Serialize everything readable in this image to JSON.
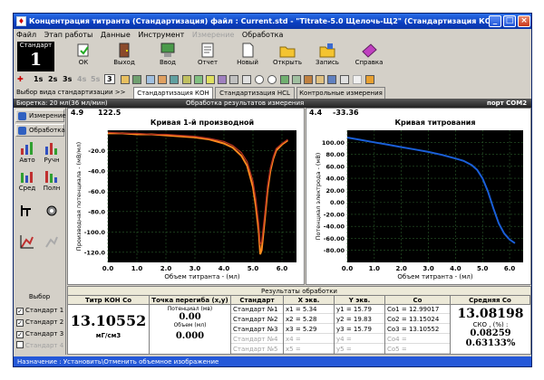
{
  "window": {
    "title": "Концентрация титранта (Стандартизация) файл : Current.std - \"Titrate-5.0 Щелочь-Щ2\" (Стандартизация КОН)"
  },
  "menu": [
    "Файл",
    "Этап работы",
    "Данные",
    "Инструмент",
    "Измерение",
    "Обработка"
  ],
  "menu_disabled": [
    4
  ],
  "toolbar": {
    "standard_label": "Стандарт",
    "standard_number": "1",
    "buttons": [
      "ОК",
      "Выход",
      "Ввод",
      "Отчет",
      "Новый",
      "Открыть",
      "Запись",
      "Справка"
    ]
  },
  "speeds": [
    "1s",
    "2s",
    "3s",
    "4s",
    "5s"
  ],
  "speed_spinner": "3",
  "tabs": {
    "lead": "Выбор вида стандартизации  >>",
    "items": [
      "Стандартизация КОН",
      "Стандартизация НCL",
      "Контрольные измерения"
    ]
  },
  "info": {
    "burette": "Бюретка: 20 мл(36 мл/мин)",
    "processing": "Обработка результатов измерения",
    "port": "порт COM2"
  },
  "left_panel": {
    "measure": "Измерение",
    "process": "Обработка",
    "icons": [
      "Авто",
      "Ручн",
      "Сред",
      "Полн"
    ],
    "vybor": "Выбор",
    "standards": [
      "Стандарт 1",
      "Стандарт 2",
      "Стандарт 3",
      "Стандарт 4",
      "Стандарт 5"
    ],
    "checked": [
      true,
      true,
      true,
      false,
      false
    ]
  },
  "chart1": {
    "readout_x": "4.9",
    "readout_y": "122.5",
    "title": "Кривая 1-й производной",
    "xlabel": "Объем титранта - (мл)",
    "ylabel": "Производная потенциала - (мВ/мл)"
  },
  "chart2": {
    "readout_x": "4.4",
    "readout_y": "-33.36",
    "title": "Кривая титрования",
    "xlabel": "Объем титранта - (мл)",
    "ylabel": "Потенциал электрода - (мВ)"
  },
  "chart_data": [
    {
      "type": "line",
      "title": "Кривая 1-й производной",
      "xlabel": "Объем титранта - (мл)",
      "ylabel": "Производная потенциала - (мВ/мл)",
      "xlim": [
        0,
        6.5
      ],
      "ylim": [
        -130,
        0
      ],
      "x_ticks": [
        "0.0",
        "1.0",
        "2.0",
        "3.0",
        "4.0",
        "5.0",
        "6.0"
      ],
      "y_ticks": [
        "-120.0",
        "-100.0",
        "-80.0",
        "-60.0",
        "-40.0",
        "-20.0"
      ],
      "grid": true,
      "series": [
        {
          "color": "#ff8a1e",
          "x": [
            0.0,
            0.5,
            1.0,
            1.5,
            2.0,
            2.5,
            3.0,
            3.5,
            4.0,
            4.3,
            4.6,
            4.8,
            5.0,
            5.1,
            5.2,
            5.25,
            5.3,
            5.4,
            5.5,
            5.6,
            5.7,
            5.8,
            6.0,
            6.2
          ],
          "y": [
            -3,
            -3,
            -4,
            -4,
            -5,
            -6,
            -7,
            -9,
            -13,
            -17,
            -25,
            -35,
            -56,
            -75,
            -100,
            -122,
            -118,
            -90,
            -60,
            -40,
            -28,
            -20,
            -14,
            -10
          ]
        },
        {
          "color": "#b03020",
          "x": [
            0.0,
            0.5,
            1.0,
            1.5,
            2.0,
            2.5,
            3.0,
            3.5,
            4.0,
            4.3,
            4.6,
            4.8,
            5.0,
            5.1,
            5.2,
            5.25,
            5.3,
            5.4,
            5.5,
            5.6,
            5.7,
            5.8,
            6.0,
            6.2
          ],
          "y": [
            -2,
            -3,
            -3,
            -4,
            -4,
            -5,
            -6,
            -8,
            -11,
            -15,
            -22,
            -31,
            -50,
            -68,
            -92,
            -112,
            -110,
            -84,
            -55,
            -37,
            -26,
            -18,
            -13,
            -9
          ]
        }
      ]
    },
    {
      "type": "line",
      "title": "Кривая титрования",
      "xlabel": "Объем титранта - (мл)",
      "ylabel": "Потенциал электрода - (мВ)",
      "xlim": [
        0,
        6.5
      ],
      "ylim": [
        -100,
        120
      ],
      "x_ticks": [
        "0.0",
        "1.0",
        "2.0",
        "3.0",
        "4.0",
        "5.0",
        "6.0"
      ],
      "y_ticks": [
        "100.00",
        "80.00",
        "60.00",
        "40.00",
        "20.00",
        "0.00",
        "-20.00",
        "-40.00",
        "-60.00",
        "-80.00"
      ],
      "grid": true,
      "series": [
        {
          "color": "#1a5fd8",
          "x": [
            0.0,
            0.5,
            1.0,
            1.5,
            2.0,
            2.5,
            3.0,
            3.5,
            4.0,
            4.3,
            4.6,
            4.8,
            5.0,
            5.2,
            5.4,
            5.6,
            5.8,
            6.0,
            6.2
          ],
          "y": [
            108,
            104,
            100,
            96,
            92,
            88,
            84,
            79,
            73,
            69,
            62,
            54,
            40,
            18,
            -10,
            -35,
            -52,
            -62,
            -68
          ]
        }
      ]
    }
  ],
  "results": {
    "title": "Результаты обработки",
    "headers": [
      "Титр КОН Co",
      "Точка перегиба (x,y)",
      "Стандарт",
      "X экв.",
      "Y экв.",
      "Co",
      "Средняя Co"
    ],
    "titer_value": "13.10552",
    "titer_unit": "мГ/см3",
    "potential_label": "Потенциал (мв)",
    "potential_value": "0.00",
    "volume_label": "Объем (мл)",
    "volume_value": "0.000",
    "standards": [
      "Стандарт №1",
      "Стандарт №2",
      "Стандарт №3",
      "Стандарт №4",
      "Стандарт №5"
    ],
    "x_eq": [
      "x1 = 5.34",
      "x2 = 5.28",
      "x3 = 5.29",
      "x4 =",
      "x5 ="
    ],
    "y_eq": [
      "y1 = 15.79",
      "y2 = 19.83",
      "y3 = 15.79",
      "y4 =",
      "y5 ="
    ],
    "co": [
      "Co1 = 12.99017",
      "Co2 = 13.15024",
      "Co3 = 13.10552",
      "Co4 =",
      "Co5 ="
    ],
    "active_rows": [
      true,
      true,
      true,
      false,
      false
    ],
    "mean_value": "13.08198",
    "sko_label": "СКО , (%) :",
    "sko_value": "0.08259",
    "sko_percent": "0.63133%"
  },
  "statusbar": "Назначение : Установить\\Отменить объемное изображение",
  "colors": {
    "title_bar": "#0a3fc0",
    "chart_bg": "#000000",
    "curve_orange": "#ff8a1e",
    "curve_blue": "#1a5fd8",
    "status_bar": "#2458d8"
  }
}
